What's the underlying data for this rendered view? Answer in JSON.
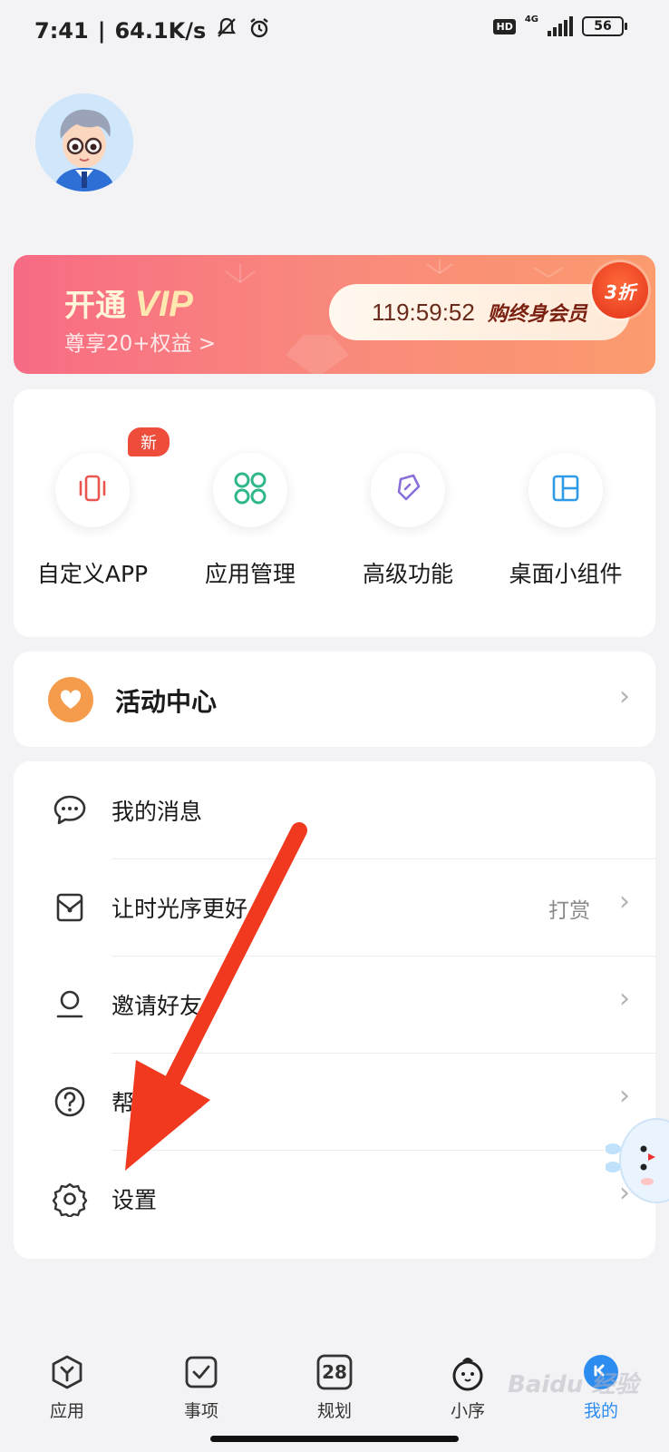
{
  "status_bar": {
    "time": "7:41",
    "speed": "64.1K/s",
    "hd": "HD",
    "network": "4G",
    "battery": "56"
  },
  "vip_banner": {
    "title_prefix": "开通",
    "title_vip": "VIP",
    "subtitle": "尊享20+权益 >",
    "countdown": "119:59:52",
    "offer": "购终身会员",
    "discount_badge": "3折"
  },
  "shortcuts": [
    {
      "label": "自定义APP",
      "icon": "phone-vibrate-icon",
      "badge": "新",
      "color": "#e8564f"
    },
    {
      "label": "应用管理",
      "icon": "grid-circles-icon",
      "color": "#2eb888"
    },
    {
      "label": "高级功能",
      "icon": "pen-nib-icon",
      "color": "#8b6fd8"
    },
    {
      "label": "桌面小组件",
      "icon": "widget-layout-icon",
      "color": "#2f9be8"
    }
  ],
  "activity": {
    "label": "活动中心",
    "icon": "heart-icon",
    "color": "#f59c4c"
  },
  "menu": [
    {
      "label": "我的消息",
      "icon": "chat-bubble-icon",
      "extra": ""
    },
    {
      "label": "让时光序更好",
      "icon": "gift-envelope-icon",
      "extra": "打赏"
    },
    {
      "label": "邀请好友",
      "icon": "person-icon",
      "extra": ""
    },
    {
      "label": "帮助中心",
      "icon": "question-circle-icon",
      "extra": ""
    },
    {
      "label": "设置",
      "icon": "gear-icon",
      "extra": ""
    }
  ],
  "tabbar": [
    {
      "label": "应用",
      "icon": "apps-hex-icon"
    },
    {
      "label": "事项",
      "icon": "check-square-icon"
    },
    {
      "label": "规划",
      "icon": "calendar-icon",
      "icon_text": "28"
    },
    {
      "label": "小序",
      "icon": "mascot-face-icon"
    },
    {
      "label": "我的",
      "icon": "profile-face-icon",
      "active": true
    }
  ],
  "watermark": "Baidu 经验",
  "colors": {
    "accent_blue": "#2c8cf0",
    "arrow_red": "#f0391e",
    "page_bg": "#f3f3f6"
  }
}
